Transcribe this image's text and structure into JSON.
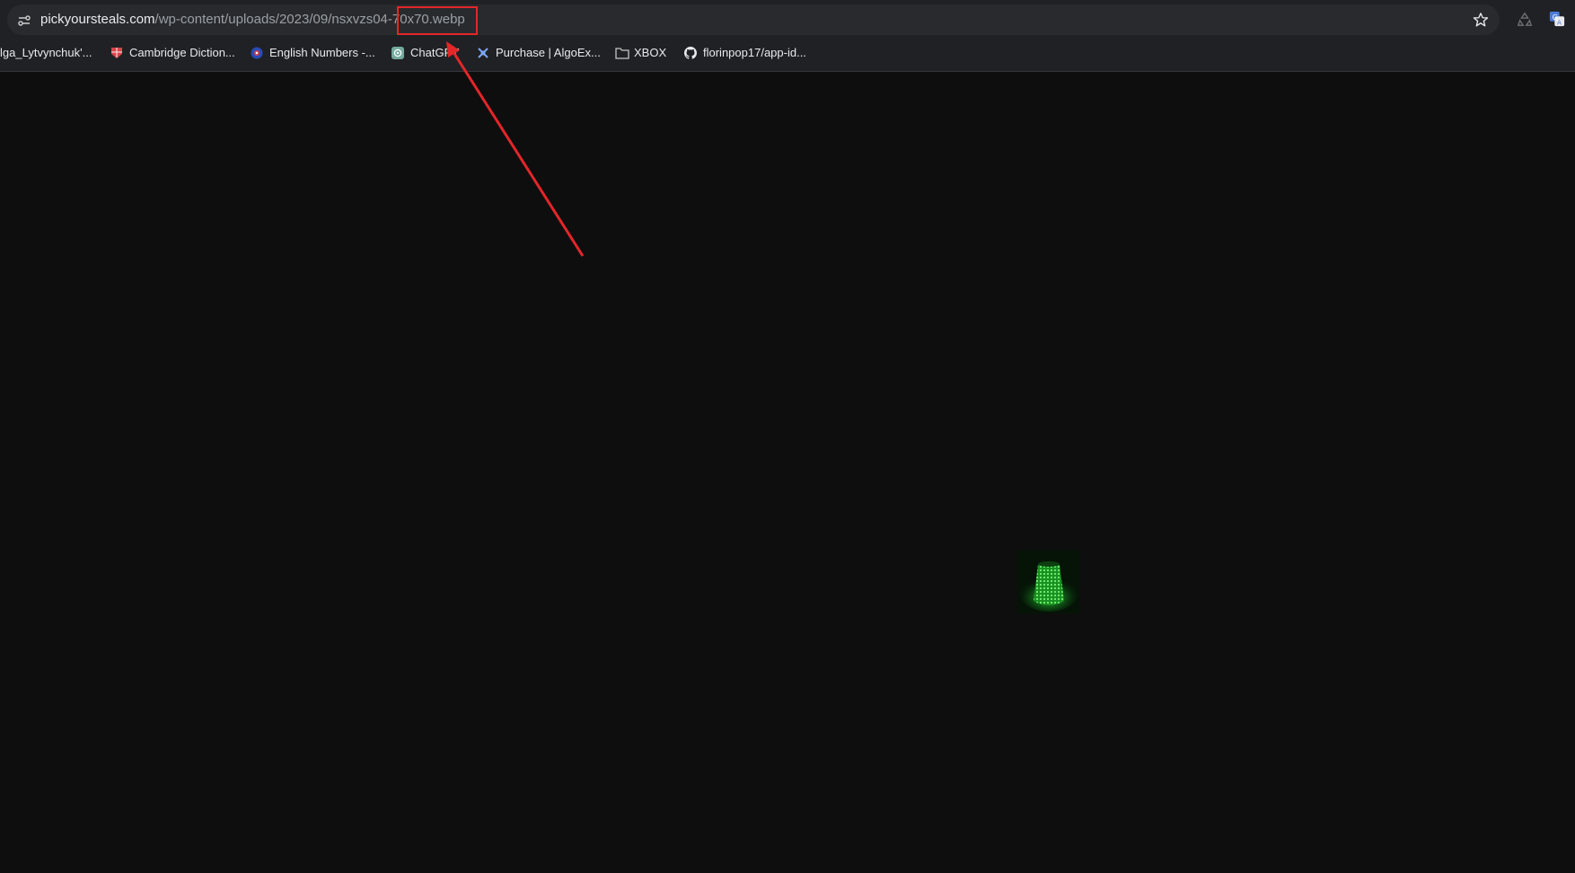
{
  "browser": {
    "url_host": "pickyoursteals.com",
    "url_path": "/wp-content/uploads/2023/09/nsxvzs04-70x70.webp"
  },
  "bookmarks": [
    {
      "label": "lga_Lytvynchuk'...",
      "icon": "bookmark-favicon-icon"
    },
    {
      "label": "Cambridge Diction...",
      "icon": "cambridge-icon"
    },
    {
      "label": "English Numbers -...",
      "icon": "english-numbers-icon"
    },
    {
      "label": "ChatGPT",
      "icon": "chatgpt-icon"
    },
    {
      "label": "Purchase | AlgoEx...",
      "icon": "algoexpert-icon"
    },
    {
      "label": "XBOX",
      "icon": "folder-icon"
    },
    {
      "label": "florinpop17/app-id...",
      "icon": "github-icon"
    }
  ],
  "viewport": {
    "background_color": "#0e0e0e",
    "image_description_icon": "green-led-lamp-image"
  },
  "annotation": {
    "color": "#e3262a",
    "highlighted_text": "70x70.webp"
  }
}
